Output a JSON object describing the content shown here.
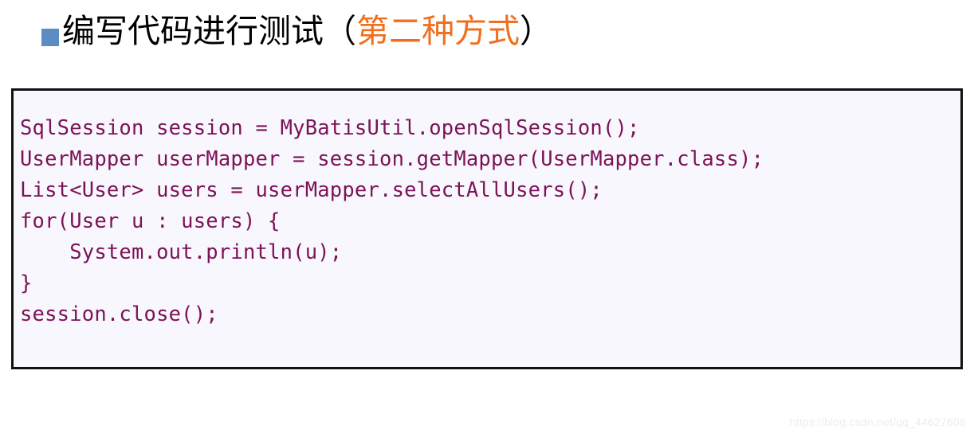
{
  "slide": {
    "heading": {
      "bullet_icon": "filled-square-bullet-icon",
      "bullet_color": "#5b8cc4",
      "text_main": "编写代码进行测试（",
      "text_accent": "第二种方式",
      "text_tail": "）",
      "accent_color": "#f0701e",
      "main_color": "#000000"
    },
    "code_block": {
      "background": "#f8f7fd",
      "border_color": "#111111",
      "text_color": "#7b1256",
      "language": "java",
      "lines": [
        "SqlSession session = MyBatisUtil.openSqlSession();",
        "UserMapper userMapper = session.getMapper(UserMapper.class);",
        "List<User> users = userMapper.selectAllUsers();",
        "for(User u : users) {",
        "    System.out.println(u);",
        "}",
        "session.close();"
      ]
    },
    "watermark": {
      "text": "https://blog.csdn.net/qq_44627608",
      "color": "#ededed"
    }
  }
}
